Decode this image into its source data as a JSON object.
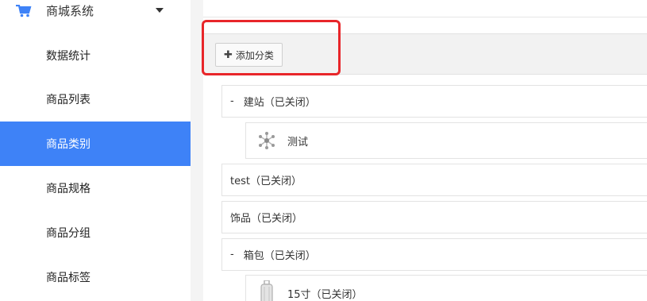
{
  "sidebar": {
    "parent": {
      "label": "商城系统",
      "icon": "cart-icon",
      "expanded": true
    },
    "items": [
      {
        "label": "数据统计",
        "active": false
      },
      {
        "label": "商品列表",
        "active": false
      },
      {
        "label": "商品类别",
        "active": true
      },
      {
        "label": "商品规格",
        "active": false
      },
      {
        "label": "商品分组",
        "active": false
      },
      {
        "label": "商品标签",
        "active": false
      }
    ]
  },
  "toolbar": {
    "add_category_label": "添加分类"
  },
  "categories": [
    {
      "prefix": "-",
      "label": "建站（已关闭）"
    },
    {
      "label": "测试",
      "icon": "molecule-icon"
    },
    {
      "label": "test（已关闭）"
    },
    {
      "label": "饰品（已关闭）"
    },
    {
      "prefix": "-",
      "label": "箱包（已关闭）"
    },
    {
      "label": "15寸（已关闭）",
      "icon": "suitcase-icon"
    }
  ],
  "colors": {
    "accent": "#3e82f7",
    "highlight": "#e8262a"
  }
}
